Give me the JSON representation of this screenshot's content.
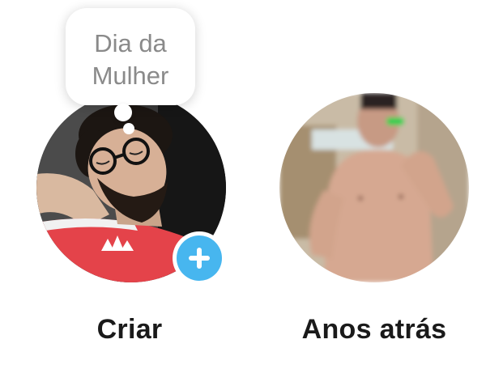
{
  "stories": [
    {
      "label": "Criar",
      "avatar_icon": "profile-photo-man-glasses-red-shirt",
      "bubble_text": "Dia da\nMulher",
      "add_icon": "plus-icon",
      "add_color": "#47b6ef"
    },
    {
      "label": "Anos atrás",
      "avatar_icon": "memory-photo-blurred"
    }
  ]
}
